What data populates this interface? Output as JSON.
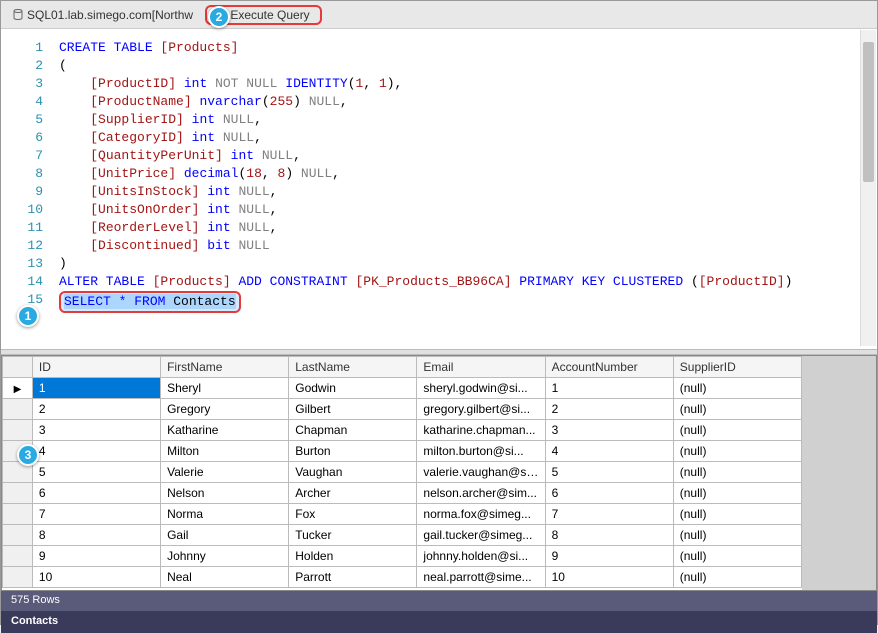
{
  "toolbar": {
    "connection": "SQL01.lab.simego.com[Northw",
    "exec_label": "Execute Query"
  },
  "callouts": {
    "c1": "1",
    "c2": "2",
    "c3": "3"
  },
  "code": {
    "lines": [
      {
        "n": "1",
        "seg": [
          {
            "t": "CREATE TABLE ",
            "c": "kw-blue"
          },
          {
            "t": "[Products]",
            "c": "kw-red"
          }
        ]
      },
      {
        "n": "2",
        "seg": [
          {
            "t": "(",
            "c": "kw-black"
          }
        ]
      },
      {
        "n": "3",
        "seg": [
          {
            "t": "    ",
            "c": ""
          },
          {
            "t": "[ProductID]",
            "c": "kw-red"
          },
          {
            "t": " int ",
            "c": "kw-blue"
          },
          {
            "t": "NOT NULL ",
            "c": "kw-gray"
          },
          {
            "t": "IDENTITY",
            "c": "kw-blue"
          },
          {
            "t": "(",
            "c": "kw-black"
          },
          {
            "t": "1",
            "c": "kw-red"
          },
          {
            "t": ", ",
            "c": "kw-black"
          },
          {
            "t": "1",
            "c": "kw-red"
          },
          {
            "t": "),",
            "c": "kw-black"
          }
        ]
      },
      {
        "n": "4",
        "seg": [
          {
            "t": "    ",
            "c": ""
          },
          {
            "t": "[ProductName]",
            "c": "kw-red"
          },
          {
            "t": " nvarchar",
            "c": "kw-blue"
          },
          {
            "t": "(",
            "c": "kw-black"
          },
          {
            "t": "255",
            "c": "kw-red"
          },
          {
            "t": ") ",
            "c": "kw-black"
          },
          {
            "t": "NULL",
            "c": "kw-gray"
          },
          {
            "t": ",",
            "c": "kw-black"
          }
        ]
      },
      {
        "n": "5",
        "seg": [
          {
            "t": "    ",
            "c": ""
          },
          {
            "t": "[SupplierID]",
            "c": "kw-red"
          },
          {
            "t": " int ",
            "c": "kw-blue"
          },
          {
            "t": "NULL",
            "c": "kw-gray"
          },
          {
            "t": ",",
            "c": "kw-black"
          }
        ]
      },
      {
        "n": "6",
        "seg": [
          {
            "t": "    ",
            "c": ""
          },
          {
            "t": "[CategoryID]",
            "c": "kw-red"
          },
          {
            "t": " int ",
            "c": "kw-blue"
          },
          {
            "t": "NULL",
            "c": "kw-gray"
          },
          {
            "t": ",",
            "c": "kw-black"
          }
        ]
      },
      {
        "n": "7",
        "seg": [
          {
            "t": "    ",
            "c": ""
          },
          {
            "t": "[QuantityPerUnit]",
            "c": "kw-red"
          },
          {
            "t": " int ",
            "c": "kw-blue"
          },
          {
            "t": "NULL",
            "c": "kw-gray"
          },
          {
            "t": ",",
            "c": "kw-black"
          }
        ]
      },
      {
        "n": "8",
        "seg": [
          {
            "t": "    ",
            "c": ""
          },
          {
            "t": "[UnitPrice]",
            "c": "kw-red"
          },
          {
            "t": " decimal",
            "c": "kw-blue"
          },
          {
            "t": "(",
            "c": "kw-black"
          },
          {
            "t": "18",
            "c": "kw-red"
          },
          {
            "t": ", ",
            "c": "kw-black"
          },
          {
            "t": "8",
            "c": "kw-red"
          },
          {
            "t": ") ",
            "c": "kw-black"
          },
          {
            "t": "NULL",
            "c": "kw-gray"
          },
          {
            "t": ",",
            "c": "kw-black"
          }
        ]
      },
      {
        "n": "9",
        "seg": [
          {
            "t": "    ",
            "c": ""
          },
          {
            "t": "[UnitsInStock]",
            "c": "kw-red"
          },
          {
            "t": " int ",
            "c": "kw-blue"
          },
          {
            "t": "NULL",
            "c": "kw-gray"
          },
          {
            "t": ",",
            "c": "kw-black"
          }
        ]
      },
      {
        "n": "10",
        "seg": [
          {
            "t": "    ",
            "c": ""
          },
          {
            "t": "[UnitsOnOrder]",
            "c": "kw-red"
          },
          {
            "t": " int ",
            "c": "kw-blue"
          },
          {
            "t": "NULL",
            "c": "kw-gray"
          },
          {
            "t": ",",
            "c": "kw-black"
          }
        ]
      },
      {
        "n": "11",
        "seg": [
          {
            "t": "    ",
            "c": ""
          },
          {
            "t": "[ReorderLevel]",
            "c": "kw-red"
          },
          {
            "t": " int ",
            "c": "kw-blue"
          },
          {
            "t": "NULL",
            "c": "kw-gray"
          },
          {
            "t": ",",
            "c": "kw-black"
          }
        ]
      },
      {
        "n": "12",
        "seg": [
          {
            "t": "    ",
            "c": ""
          },
          {
            "t": "[Discontinued]",
            "c": "kw-red"
          },
          {
            "t": " bit ",
            "c": "kw-blue"
          },
          {
            "t": "NULL",
            "c": "kw-gray"
          }
        ]
      },
      {
        "n": "13",
        "seg": [
          {
            "t": ")",
            "c": "kw-black"
          }
        ]
      },
      {
        "n": "14",
        "seg": [
          {
            "t": "ALTER TABLE ",
            "c": "kw-blue"
          },
          {
            "t": "[Products]",
            "c": "kw-red"
          },
          {
            "t": " ADD CONSTRAINT ",
            "c": "kw-blue"
          },
          {
            "t": "[PK_Products_BB96CA]",
            "c": "kw-red"
          },
          {
            "t": " PRIMARY KEY CLUSTERED ",
            "c": "kw-blue"
          },
          {
            "t": "(",
            "c": "kw-black"
          },
          {
            "t": "[ProductID]",
            "c": "kw-red"
          },
          {
            "t": ")",
            "c": "kw-black"
          }
        ]
      }
    ],
    "sel_line_n": "15",
    "sel_sql": "SELECT * FROM",
    "sel_table": " Contacts"
  },
  "grid": {
    "headers": [
      "ID",
      "FirstName",
      "LastName",
      "Email",
      "AccountNumber",
      "SupplierID"
    ],
    "rows": [
      {
        "id": "1",
        "fn": "Sheryl",
        "ln": "Godwin",
        "em": "sheryl.godwin@si...",
        "ac": "1",
        "sp": "(null)",
        "sel": true
      },
      {
        "id": "2",
        "fn": "Gregory",
        "ln": "Gilbert",
        "em": "gregory.gilbert@si...",
        "ac": "2",
        "sp": "(null)"
      },
      {
        "id": "3",
        "fn": "Katharine",
        "ln": "Chapman",
        "em": "katharine.chapman...",
        "ac": "3",
        "sp": "(null)"
      },
      {
        "id": "4",
        "fn": "Milton",
        "ln": "Burton",
        "em": "milton.burton@si...",
        "ac": "4",
        "sp": "(null)"
      },
      {
        "id": "5",
        "fn": "Valerie",
        "ln": "Vaughan",
        "em": "valerie.vaughan@si...",
        "ac": "5",
        "sp": "(null)"
      },
      {
        "id": "6",
        "fn": "Nelson",
        "ln": "Archer",
        "em": "nelson.archer@sim...",
        "ac": "6",
        "sp": "(null)"
      },
      {
        "id": "7",
        "fn": "Norma",
        "ln": "Fox",
        "em": "norma.fox@simeg...",
        "ac": "7",
        "sp": "(null)"
      },
      {
        "id": "8",
        "fn": "Gail",
        "ln": "Tucker",
        "em": "gail.tucker@simeg...",
        "ac": "8",
        "sp": "(null)"
      },
      {
        "id": "9",
        "fn": "Johnny",
        "ln": "Holden",
        "em": "johnny.holden@si...",
        "ac": "9",
        "sp": "(null)"
      },
      {
        "id": "10",
        "fn": "Neal",
        "ln": "Parrott",
        "em": "neal.parrott@sime...",
        "ac": "10",
        "sp": "(null)"
      }
    ]
  },
  "status": {
    "rows": "575 Rows"
  },
  "footer": {
    "tab": "Contacts"
  }
}
